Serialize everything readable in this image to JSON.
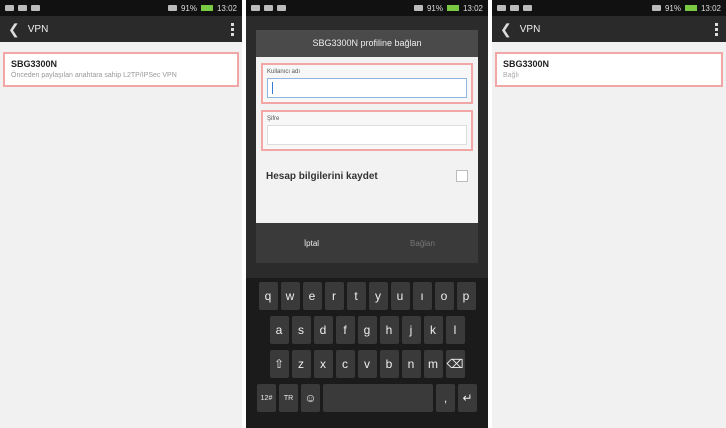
{
  "screen1": {
    "time": "13:02",
    "battery": "91%",
    "title": "VPN",
    "item": {
      "name": "SBG3300N",
      "subtitle": "Önceden paylaşılan anahtara sahip L2TP/IPSec VPN"
    }
  },
  "screen2": {
    "time": "13:02",
    "battery": "91%",
    "dialog": {
      "title": "SBG3300N profiline bağlan",
      "username_label": "Kullanıcı adı",
      "username_value": "",
      "password_label": "Şifre",
      "password_value": "",
      "save_label": "Hesap bilgilerini kaydet",
      "cancel_label": "İptal",
      "connect_label": "Bağlan"
    },
    "keyboard": {
      "row1": [
        "q",
        "w",
        "e",
        "r",
        "t",
        "y",
        "u",
        "ı",
        "o",
        "p"
      ],
      "row2": [
        "a",
        "s",
        "d",
        "f",
        "g",
        "h",
        "j",
        "k",
        "l"
      ],
      "row3": [
        "⇧",
        "z",
        "x",
        "c",
        "v",
        "b",
        "n",
        "m",
        "⌫"
      ],
      "row4": [
        "12#",
        "TR",
        "☺",
        "",
        ",",
        "↵"
      ]
    }
  },
  "screen3": {
    "time": "13:02",
    "battery": "91%",
    "title": "VPN",
    "item": {
      "name": "SBG3300N",
      "subtitle": "Bağlı"
    }
  }
}
